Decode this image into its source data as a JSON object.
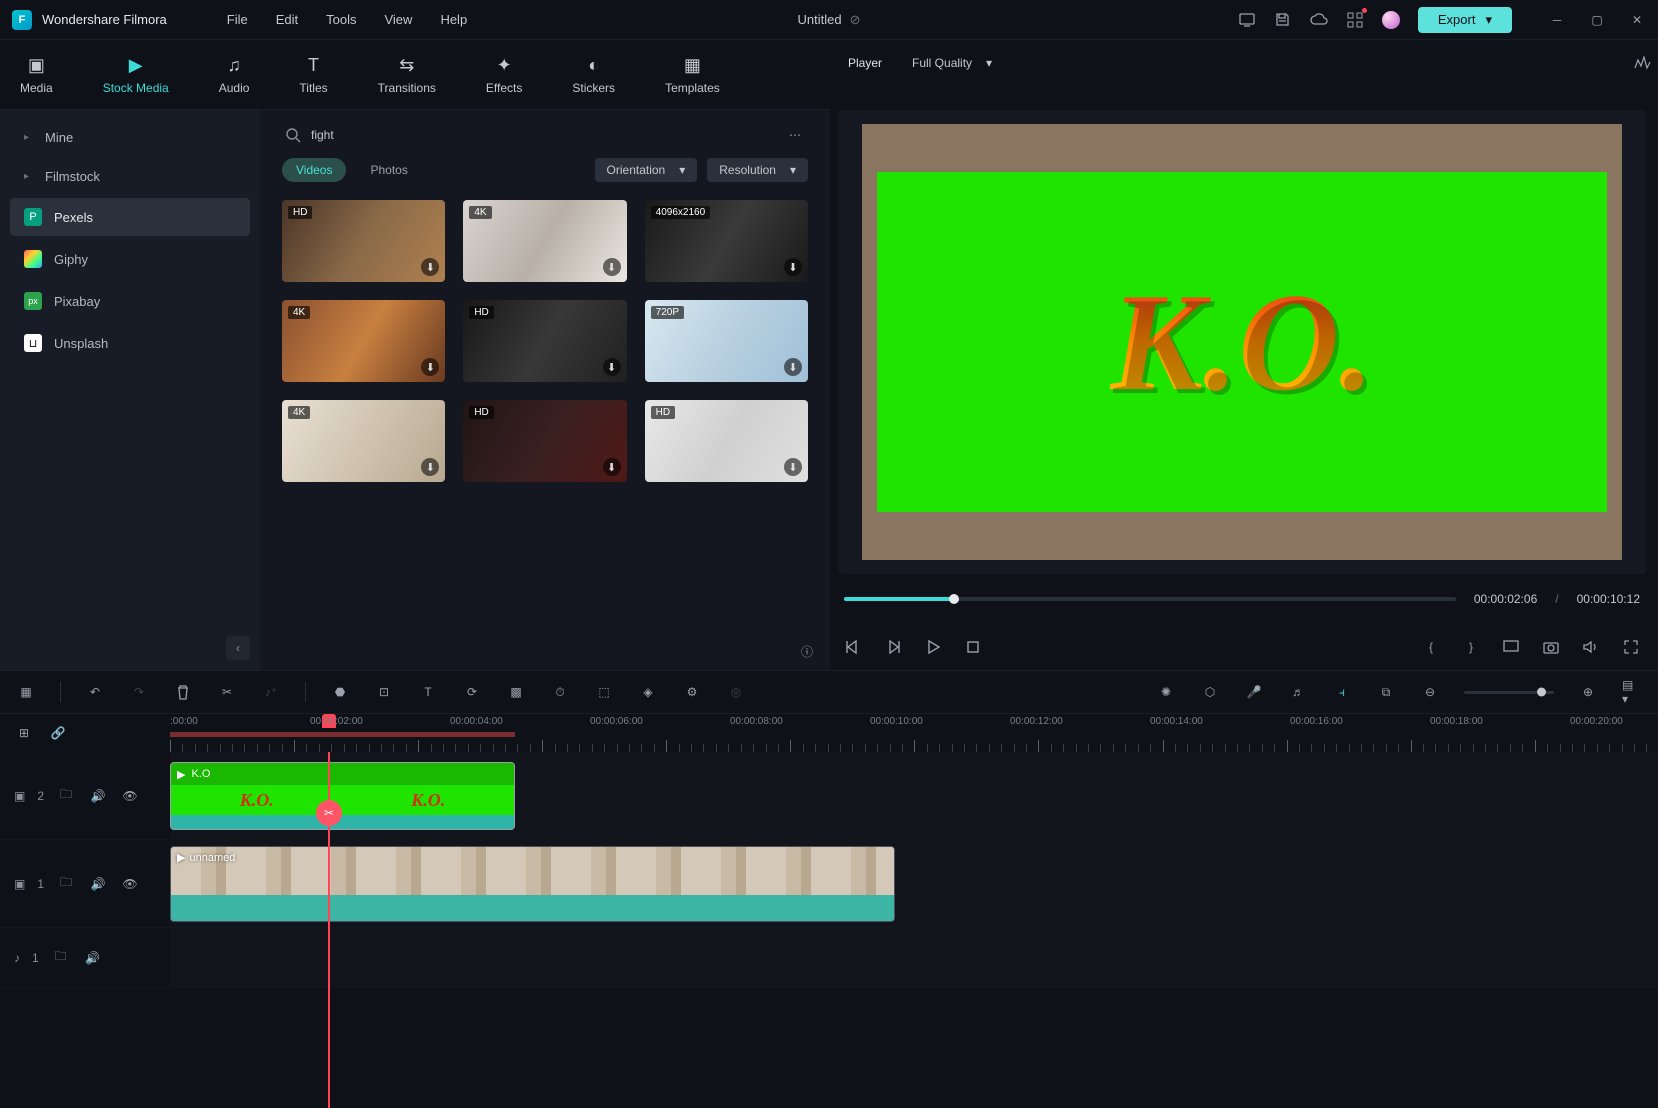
{
  "app": {
    "name": "Wondershare Filmora",
    "doc_title": "Untitled"
  },
  "menu": [
    "File",
    "Edit",
    "Tools",
    "View",
    "Help"
  ],
  "export_label": "Export",
  "tabs": [
    "Media",
    "Stock Media",
    "Audio",
    "Titles",
    "Transitions",
    "Effects",
    "Stickers",
    "Templates"
  ],
  "active_tab": 1,
  "sidebar": {
    "items": [
      {
        "label": "Mine",
        "icon": "",
        "chevron": true
      },
      {
        "label": "Filmstock",
        "icon": "",
        "chevron": true
      },
      {
        "label": "Pexels",
        "icon": "P",
        "bg": "#06a081",
        "active": true
      },
      {
        "label": "Giphy",
        "icon": "G",
        "bg": "linear-gradient(135deg,#ff5e5e,#ffd02e,#3cff8a,#3ca0ff)"
      },
      {
        "label": "Pixabay",
        "icon": "px",
        "bg": "#2ca24c"
      },
      {
        "label": "Unsplash",
        "icon": "U",
        "bg": "#ffffff"
      }
    ]
  },
  "search": {
    "query": "fight"
  },
  "media_tabs": {
    "videos": "Videos",
    "photos": "Photos"
  },
  "filters": {
    "orientation": "Orientation",
    "resolution": "Resolution"
  },
  "thumbs": [
    {
      "badge": "HD",
      "bg": "linear-gradient(120deg,#4a3528,#8a6a48,#b08050)"
    },
    {
      "badge": "4K",
      "bg": "linear-gradient(120deg,#d8d4d0,#b8b0a8,#eae6e0)"
    },
    {
      "badge": "4096x2160",
      "bg": "linear-gradient(120deg,#1a1a1a,#3a3a3a,#1a1a1a)"
    },
    {
      "badge": "4K",
      "bg": "linear-gradient(120deg,#8a5030,#c88040,#6a3a20)"
    },
    {
      "badge": "HD",
      "bg": "linear-gradient(120deg,#181818,#383838,#202020)"
    },
    {
      "badge": "720P",
      "bg": "linear-gradient(120deg,#d8e8f0,#b8d0e0,#a0c0d8)"
    },
    {
      "badge": "4K",
      "bg": "linear-gradient(120deg,#e8e0d4,#d0c4b0,#b8a890)"
    },
    {
      "badge": "HD",
      "bg": "linear-gradient(120deg,#201515,#3a2020,#501818)"
    },
    {
      "badge": "HD",
      "bg": "linear-gradient(120deg,#e8e8e8,#d0d0d0,#e0e0e0)"
    }
  ],
  "preview": {
    "tab": "Player",
    "quality": "Full Quality",
    "ko": "K.O.",
    "current": "00:00:02:06",
    "sep": "/",
    "total": "00:00:10:12"
  },
  "ruler": [
    ":00:00",
    "00:00:02:00",
    "00:00:04:00",
    "00:00:06:00",
    "00:00:08:00",
    "00:00:10:00",
    "00:00:12:00",
    "00:00:14:00",
    "00:00:16:00",
    "00:00:18:00",
    "00:00:20:00"
  ],
  "tracks": {
    "v2": {
      "type": "video",
      "num": "2",
      "clip_label": "K.O"
    },
    "v1": {
      "type": "video",
      "num": "1",
      "clip_label": "unnamed"
    },
    "a1": {
      "type": "audio",
      "num": "1"
    }
  }
}
